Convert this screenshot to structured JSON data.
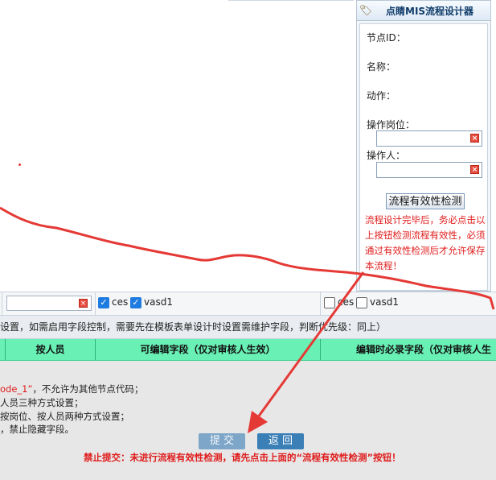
{
  "panel": {
    "title": "点睛MIS流程设计器",
    "labels": {
      "node_id": "节点ID：",
      "name": "名称：",
      "action": "动作：",
      "post": "操作岗位：",
      "operator": "操作人："
    },
    "check_button": "流程有效性检测",
    "warning": "流程设计完毕后，务必点击以上按钮检测流程有效性，必须通过有效性检测后才允许保存本流程！"
  },
  "filter_row": {
    "left_checks": [
      {
        "label": "ces",
        "checked": true
      },
      {
        "label": "vasd1",
        "checked": true
      }
    ],
    "right_checks": [
      {
        "label": "ces",
        "checked": false
      },
      {
        "label": "vasd1",
        "checked": false
      }
    ]
  },
  "note_row": "设置，如需启用字段控制，需要先在模板表单设计时设置需维护字段，判断优先级：同上）",
  "table_header": {
    "col_person": "按人员",
    "col_editable": "可编辑字段（仅对审核人生效）",
    "col_required": "编辑时必录字段（仅对审核人生效"
  },
  "hints": {
    "line1_red": "ode_1”",
    "line1_rest": "，不允许为其他节点代码；",
    "line2": "人员三种方式设置；",
    "line3": "按岗位、按人员两种方式设置；",
    "line4": "，禁止隐藏字段。"
  },
  "buttons": {
    "submit": "提 交",
    "back": "返 回"
  },
  "forbid_message": "禁止提交：未进行流程有效性检测，请先点击上面的“流程有效性检测”按钮！",
  "colors": {
    "accent_red": "#e53935",
    "header_green": "#69f0b4",
    "button_blue": "#3b7fb7"
  }
}
